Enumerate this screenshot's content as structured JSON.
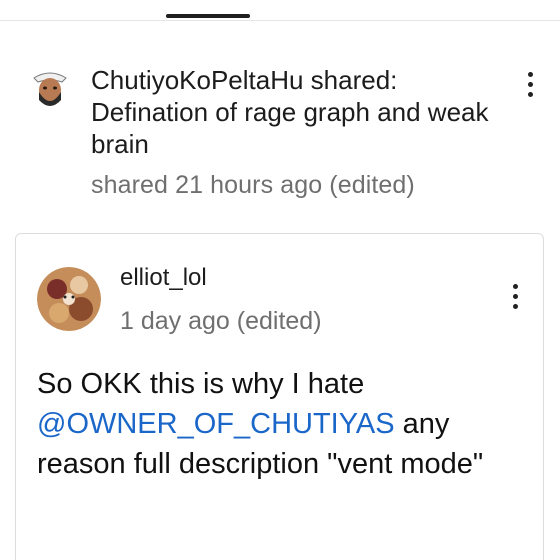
{
  "shared_post": {
    "author_label": "ChutiyoKoPeltaHu shared:",
    "title": "Defination of rage graph and weak brain",
    "timestamp": "shared 21 hours ago (edited)"
  },
  "comment": {
    "username": "elliot_lol",
    "timestamp": "1 day ago (edited)",
    "text_before": "So OKK this is why I hate ",
    "mention": "@OWNER_OF_CHUTIYAS",
    "text_after": " any reason full description  \"vent mode\""
  },
  "colors": {
    "mention": "#1a66c9",
    "secondary_text": "#6f6f6f"
  },
  "icons": {
    "share_avatar": "user-avatar-icon",
    "share_menu": "kebab-menu-icon",
    "comment_avatar": "user-avatar-icon",
    "comment_menu": "kebab-menu-icon"
  }
}
